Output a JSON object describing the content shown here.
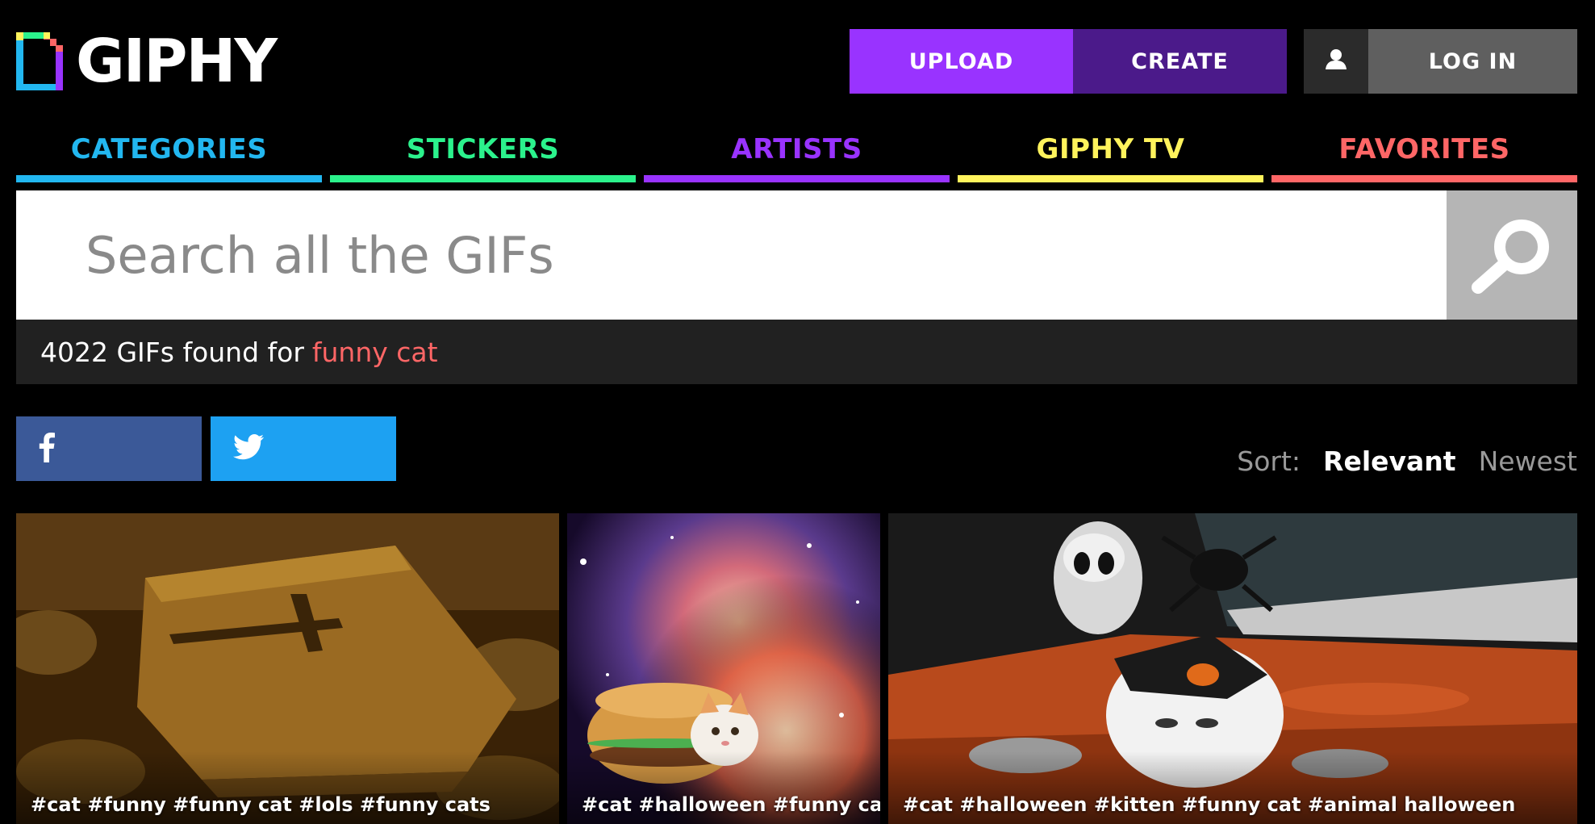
{
  "header": {
    "logo_text": "GIPHY",
    "upload_label": "UPLOAD",
    "create_label": "CREATE",
    "login_label": "LOG IN",
    "user_icon": "user-icon"
  },
  "nav": {
    "items": [
      {
        "label": "CATEGORIES",
        "color": "#22b7f0"
      },
      {
        "label": "STICKERS",
        "color": "#2bf28c"
      },
      {
        "label": "ARTISTS",
        "color": "#9933ff"
      },
      {
        "label": "GIPHY TV",
        "color": "#fff35c"
      },
      {
        "label": "FAVORITES",
        "color": "#ff6666"
      }
    ]
  },
  "search": {
    "placeholder": "Search all the GIFs",
    "button_icon": "search-icon"
  },
  "results": {
    "count_text": "4022 GIFs found for",
    "query": "funny cat"
  },
  "share": {
    "facebook_icon": "facebook-icon",
    "twitter_icon": "twitter-icon"
  },
  "sort": {
    "label": "Sort:",
    "options": [
      "Relevant",
      "Newest"
    ],
    "selected": "Relevant"
  },
  "gifs": [
    {
      "tags": "#cat #funny #funny cat #lols #funny cats"
    },
    {
      "tags": "#cat #halloween #funny cat"
    },
    {
      "tags": "#cat #halloween #kitten #funny cat #animal halloween"
    }
  ],
  "colors": {
    "upload": "#9933ff",
    "create": "#4b1a8a",
    "login": "#5f5f5f",
    "facebook": "#3b5998",
    "twitter": "#1da1f2",
    "query": "#ff6666"
  }
}
